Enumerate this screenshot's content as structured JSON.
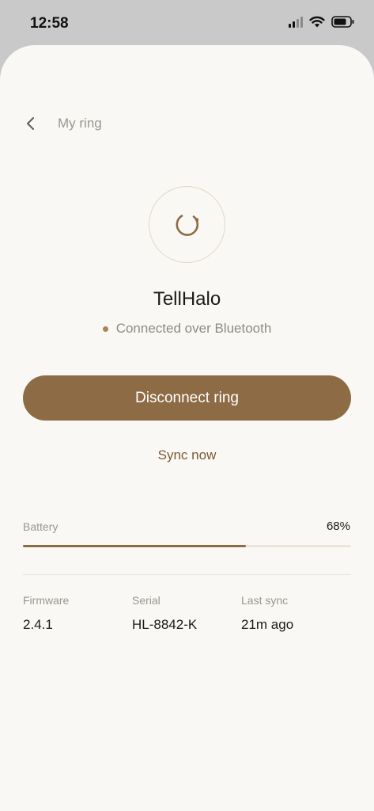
{
  "status_bar": {
    "time": "12:58"
  },
  "header": {
    "title": "My ring"
  },
  "device": {
    "name": "TellHalo",
    "connection_status": "Connected over Bluetooth"
  },
  "actions": {
    "disconnect_label": "Disconnect ring",
    "sync_label": "Sync now"
  },
  "battery": {
    "label": "Battery",
    "value_text": "68%",
    "level_fraction": 0.68
  },
  "details": [
    {
      "label": "Firmware",
      "value": "2.4.1"
    },
    {
      "label": "Serial",
      "value": "HL-8842-K"
    },
    {
      "label": "Last sync",
      "value": "21m ago"
    }
  ],
  "colors": {
    "accent": "#8d6b45",
    "status_dot": "#a78555",
    "background": "#faf8f5"
  }
}
